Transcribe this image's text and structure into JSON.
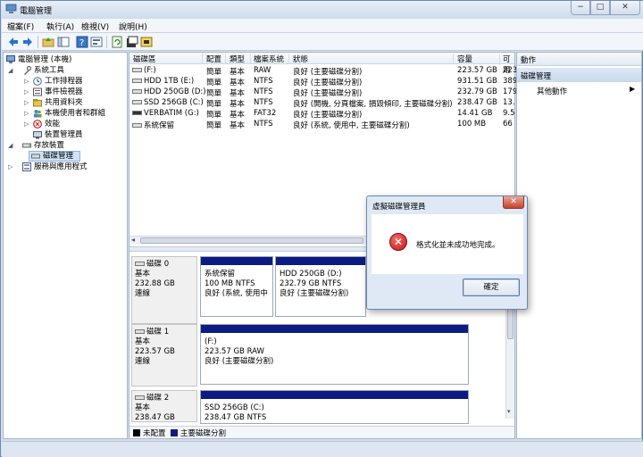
{
  "window": {
    "title": "電腦管理"
  },
  "window_buttons": {
    "minimize": "−",
    "maximize": "□",
    "close": "✕"
  },
  "menu": [
    {
      "label": "檔案(F)"
    },
    {
      "label": "執行(A)"
    },
    {
      "label": "檢視(V)"
    },
    {
      "label": "說明(H)"
    }
  ],
  "tree": [
    {
      "label": "電腦管理 (本機)",
      "indent": 0,
      "arrow": "",
      "icon": "computer-icon"
    },
    {
      "label": "系統工具",
      "indent": 1,
      "arrow": "◢",
      "icon": "tools-icon"
    },
    {
      "label": "工作排程器",
      "indent": 2,
      "arrow": "▷",
      "icon": "clock-icon"
    },
    {
      "label": "事件檢視器",
      "indent": 2,
      "arrow": "▷",
      "icon": "event-icon"
    },
    {
      "label": "共用資料夾",
      "indent": 2,
      "arrow": "▷",
      "icon": "folder-icon"
    },
    {
      "label": "本機使用者和群組",
      "indent": 2,
      "arrow": "▷",
      "icon": "users-icon"
    },
    {
      "label": "效能",
      "indent": 2,
      "arrow": "▷",
      "icon": "performance-icon"
    },
    {
      "label": "裝置管理員",
      "indent": 2,
      "arrow": "",
      "icon": "device-icon"
    },
    {
      "label": "存放裝置",
      "indent": 1,
      "arrow": "◢",
      "icon": "storage-icon"
    },
    {
      "label": "磁碟管理",
      "indent": 2,
      "arrow": "",
      "icon": "disk-icon",
      "selected": true
    },
    {
      "label": "服務與應用程式",
      "indent": 1,
      "arrow": "▷",
      "icon": "services-icon"
    }
  ],
  "volume_table": {
    "columns": [
      "磁碟區",
      "配置",
      "類型",
      "檔案系統",
      "狀態",
      "容量",
      "可用"
    ],
    "rows": [
      {
        "name": "(F:)",
        "layout": "簡單",
        "type": "基本",
        "fs": "RAW",
        "status": "良好 (主要磁碟分割)",
        "capacity": "223.57 GB",
        "free": "223"
      },
      {
        "name": "HDD 1TB (E:)",
        "layout": "簡單",
        "type": "基本",
        "fs": "NTFS",
        "status": "良好 (主要磁碟分割)",
        "capacity": "931.51 GB",
        "free": "389"
      },
      {
        "name": "HDD 250GB (D:)",
        "layout": "簡單",
        "type": "基本",
        "fs": "NTFS",
        "status": "良好 (主要磁碟分割)",
        "capacity": "232.79 GB",
        "free": "179"
      },
      {
        "name": "SSD 256GB (C:)",
        "layout": "簡單",
        "type": "基本",
        "fs": "NTFS",
        "status": "良好 (開機, 分頁檔案, 損毀傾印, 主要磁碟分割)",
        "capacity": "238.47 GB",
        "free": "13."
      },
      {
        "name": "VERBATIM (G:)",
        "layout": "簡單",
        "type": "基本",
        "fs": "FAT32",
        "status": "良好 (主要磁碟分割)",
        "capacity": "14.41 GB",
        "free": "9.5"
      },
      {
        "name": "系統保留",
        "layout": "簡單",
        "type": "基本",
        "fs": "NTFS",
        "status": "良好 (系統, 使用中, 主要磁碟分割)",
        "capacity": "100 MB",
        "free": "66"
      }
    ]
  },
  "disks": [
    {
      "title": "磁碟 0",
      "type": "基本",
      "size": "232.88 GB",
      "state": "連線",
      "partitions": [
        {
          "name": "系統保留",
          "size": "100 MB NTFS",
          "status": "良好 (系統, 使用中"
        },
        {
          "name": "HDD 250GB  (D:)",
          "size": "232.79 GB NTFS",
          "status": "良好 (主要磁碟分割)"
        }
      ]
    },
    {
      "title": "磁碟 1",
      "type": "基本",
      "size": "223.57 GB",
      "state": "連線",
      "partitions": [
        {
          "name": "(F:)",
          "size": "223.57 GB RAW",
          "status": "良好 (主要磁碟分割)"
        }
      ]
    },
    {
      "title": "磁碟 2",
      "type": "基本",
      "size": "238.47 GB",
      "state": "",
      "partitions": [
        {
          "name": "SSD 256GB  (C:)",
          "size": "238.47 GB NTFS",
          "status": ""
        }
      ]
    }
  ],
  "legend": [
    {
      "label": "未配置",
      "color": "#000000"
    },
    {
      "label": "主要磁碟分割",
      "color": "#0b1b83"
    }
  ],
  "actions": {
    "header": "動作",
    "section": "磁碟管理",
    "more": "其他動作",
    "more_arrow": "▶"
  },
  "dialog": {
    "title": "虛擬磁碟管理員",
    "close": "✕",
    "icon_glyph": "✕",
    "message": "格式化並未成功地完成。",
    "ok_label": "確定"
  },
  "colors": {
    "partition_bar": "#0b1b83",
    "selection": "#cde3f7"
  }
}
